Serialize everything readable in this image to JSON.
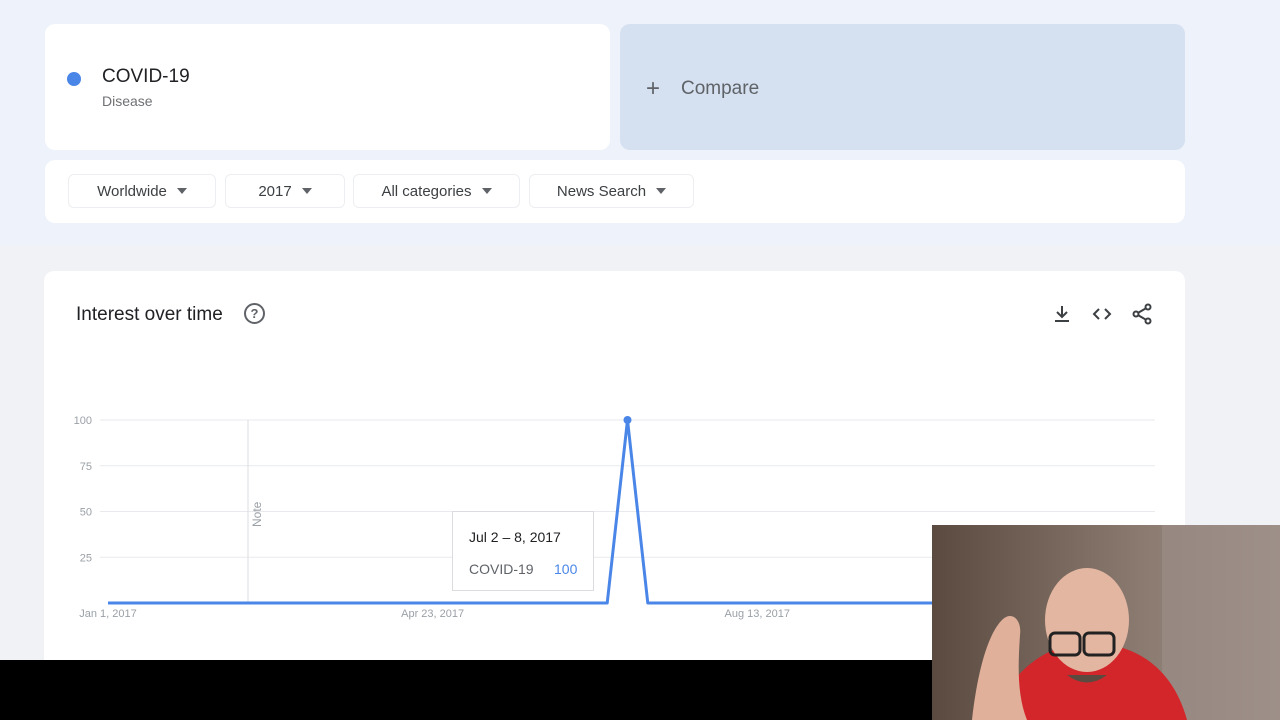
{
  "search_term": {
    "name": "COVID-19",
    "type": "Disease",
    "color": "#4a86e8"
  },
  "compare": {
    "icon": "plus-icon",
    "label": "Compare"
  },
  "filters": {
    "region": "Worldwide",
    "time": "2017",
    "category": "All categories",
    "search_type": "News Search"
  },
  "chart_panel": {
    "title": "Interest over time",
    "help_icon": "help-circle-icon",
    "actions": [
      "download-icon",
      "embed-code-icon",
      "share-icon"
    ]
  },
  "chart_data": {
    "type": "line",
    "x": [
      "Jan 1, 2017",
      "Jun 25, 2017",
      "Jul 2, 2017",
      "Jul 9, 2017",
      "Dec 31, 2017"
    ],
    "series": [
      {
        "values": [
          0,
          0,
          100,
          0,
          0
        ]
      }
    ],
    "x_tick_labels": [
      "Jan 1, 2017",
      "Apr 23, 2017",
      "Aug 13, 2017"
    ],
    "y_ticks": [
      25,
      50,
      75,
      100
    ],
    "ylim": [
      0,
      100
    ],
    "grid": true,
    "note_label": "Note",
    "color": "#4a86e8"
  },
  "tooltip": {
    "date": "Jul 2 – 8, 2017",
    "series": "COVID-19",
    "value": "100"
  }
}
